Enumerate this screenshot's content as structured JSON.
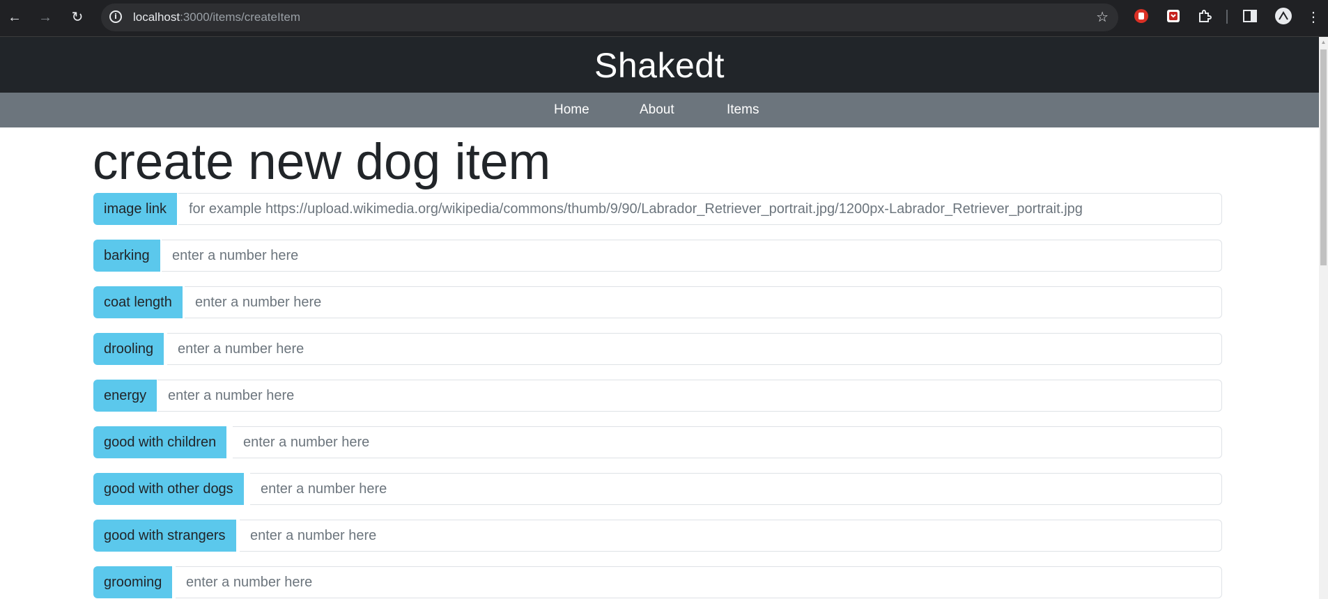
{
  "browser": {
    "url_host": "localhost",
    "url_path": ":3000/items/createItem"
  },
  "header": {
    "title": "Shakedt"
  },
  "nav": {
    "items": [
      "Home",
      "About",
      "Items"
    ]
  },
  "form": {
    "title": "create new dog item",
    "fields": [
      {
        "label": "image link",
        "placeholder": "for example https://upload.wikimedia.org/wikipedia/commons/thumb/9/90/Labrador_Retriever_portrait.jpg/1200px-Labrador_Retriever_portrait.jpg"
      },
      {
        "label": "barking",
        "placeholder": "enter a number here"
      },
      {
        "label": "coat length",
        "placeholder": "enter a number here"
      },
      {
        "label": "drooling",
        "placeholder": "enter a number here"
      },
      {
        "label": "energy",
        "placeholder": "enter a number here"
      },
      {
        "label": "good with children",
        "placeholder": "enter a number here"
      },
      {
        "label": "good with other dogs",
        "placeholder": "enter a number here"
      },
      {
        "label": "good with strangers",
        "placeholder": "enter a number here"
      },
      {
        "label": "grooming",
        "placeholder": "enter a number here"
      }
    ]
  },
  "colors": {
    "label_bg": "#5bc8ec",
    "header_bg": "#212529",
    "nav_bg": "#6c757d"
  }
}
